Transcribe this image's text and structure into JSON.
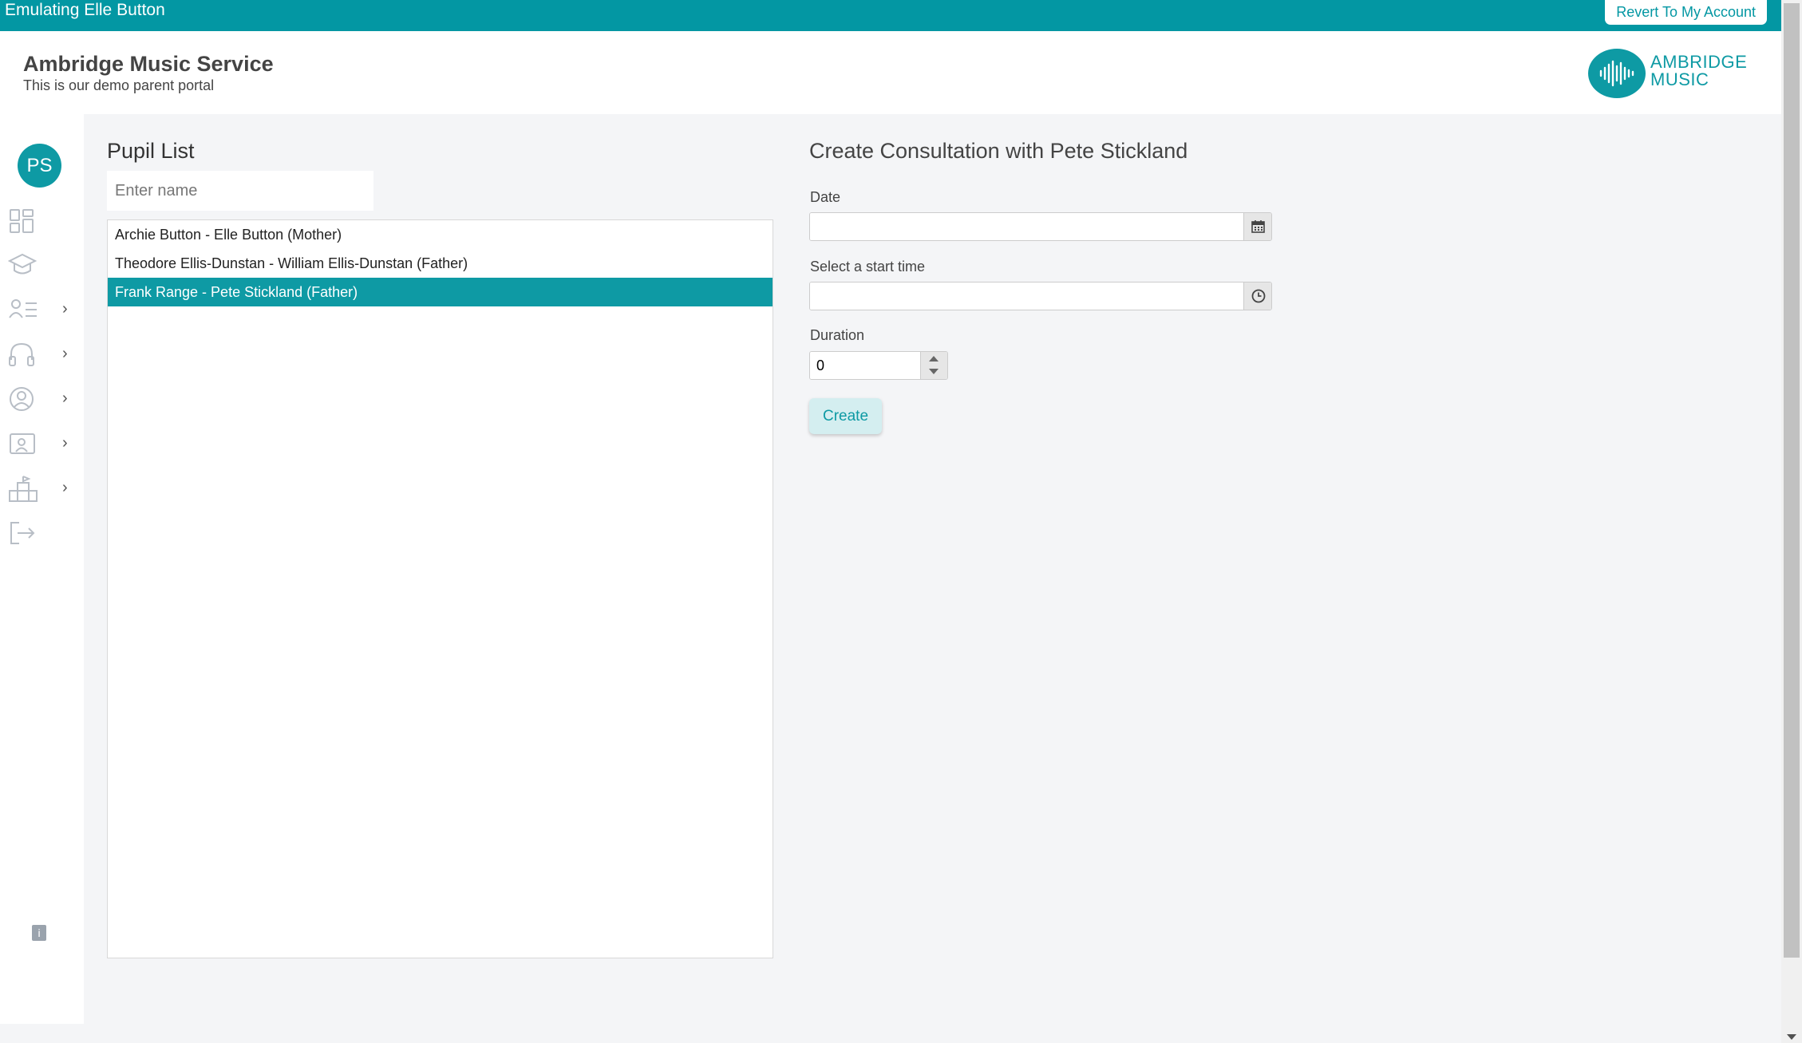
{
  "emulation_bar": {
    "text": "Emulating Elle Button",
    "revert_label": "Revert To My Account"
  },
  "header": {
    "title": "Ambridge Music Service",
    "subtitle": "This is our demo parent portal",
    "logo_line1": "AMBRIDGE",
    "logo_line2": "MUSIC"
  },
  "sidebar": {
    "avatar_initials": "PS",
    "items": [
      {
        "icon": "dashboard-icon",
        "has_chevron": false
      },
      {
        "icon": "graduation-cap-icon",
        "has_chevron": false
      },
      {
        "icon": "user-list-icon",
        "has_chevron": true
      },
      {
        "icon": "headphones-icon",
        "has_chevron": true
      },
      {
        "icon": "user-circle-icon",
        "has_chevron": true
      },
      {
        "icon": "contact-card-icon",
        "has_chevron": true
      },
      {
        "icon": "org-chart-icon",
        "has_chevron": true
      },
      {
        "icon": "logout-icon",
        "has_chevron": false
      }
    ],
    "info_badge": "i"
  },
  "pupil_list": {
    "title": "Pupil List",
    "search_placeholder": "Enter name",
    "rows": [
      {
        "label": "Archie Button - Elle Button (Mother)",
        "selected": false
      },
      {
        "label": "Theodore Ellis-Dunstan - William Ellis-Dunstan (Father)",
        "selected": false
      },
      {
        "label": "Frank Range - Pete Stickland (Father)",
        "selected": true
      }
    ]
  },
  "consultation_form": {
    "title": "Create Consultation with Pete Stickland",
    "date_label": "Date",
    "date_value": "",
    "start_time_label": "Select a start time",
    "start_time_value": "",
    "duration_label": "Duration",
    "duration_value": "0",
    "create_label": "Create"
  },
  "colors": {
    "accent": "#0e9aa4",
    "emulation_bar": "#0397a3",
    "page_bg": "#f4f5f7"
  }
}
